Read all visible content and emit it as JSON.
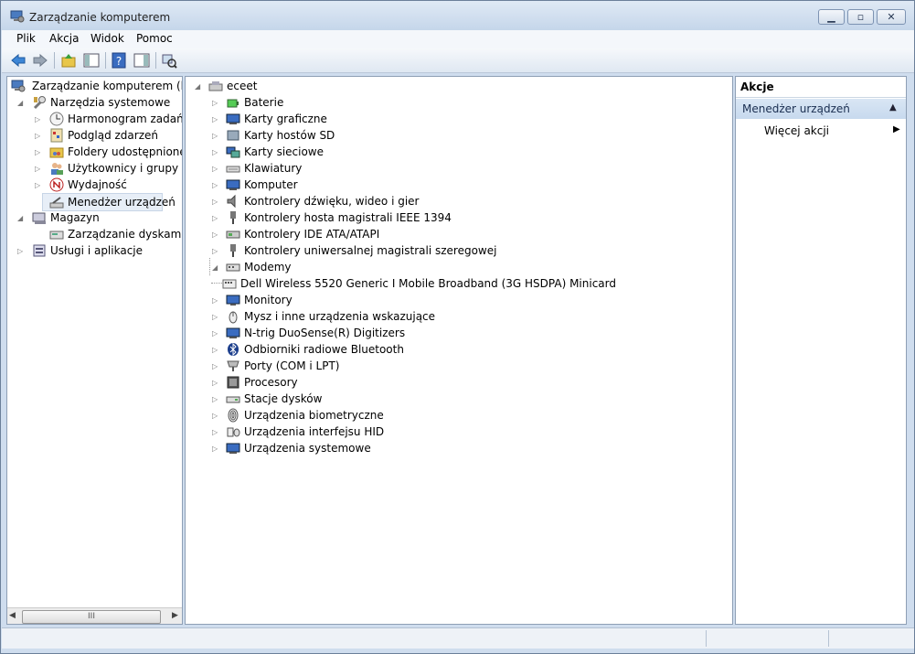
{
  "window": {
    "title": "Zarządzanie komputerem"
  },
  "menu": [
    "Plik",
    "Akcja",
    "Widok",
    "Pomoc"
  ],
  "left_tree": {
    "root": "Zarządzanie komputerem (loka",
    "system_tools": "Narzędzia systemowe",
    "items": [
      "Harmonogram zadań",
      "Podgląd zdarzeń",
      "Foldery udostępnione",
      "Użytkownicy i grupy lok",
      "Wydajność",
      "Menedżer urządzeń"
    ],
    "storage": "Magazyn",
    "disk_mgmt": "Zarządzanie dyskami",
    "services": "Usługi i aplikacje",
    "scroll_thumb": "III"
  },
  "device_tree": {
    "computer": "eceet",
    "categories": [
      {
        "label": "Baterie",
        "icon": "battery-icon"
      },
      {
        "label": "Karty graficzne",
        "icon": "display-adapter-icon"
      },
      {
        "label": "Karty hostów SD",
        "icon": "sd-host-icon"
      },
      {
        "label": "Karty sieciowe",
        "icon": "network-adapter-icon"
      },
      {
        "label": "Klawiatury",
        "icon": "keyboard-icon"
      },
      {
        "label": "Komputer",
        "icon": "computer-icon"
      },
      {
        "label": "Kontrolery dźwięku, wideo i gier",
        "icon": "speaker-icon"
      },
      {
        "label": "Kontrolery hosta magistrali IEEE 1394",
        "icon": "ieee1394-icon"
      },
      {
        "label": "Kontrolery IDE ATA/ATAPI",
        "icon": "ide-controller-icon"
      },
      {
        "label": "Kontrolery uniwersalnej magistrali szeregowej",
        "icon": "usb-icon"
      },
      {
        "label": "Modemy",
        "icon": "modem-icon",
        "expanded": true
      },
      {
        "label": "Monitory",
        "icon": "monitor-icon"
      },
      {
        "label": "Mysz i inne urządzenia wskazujące",
        "icon": "mouse-icon"
      },
      {
        "label": "N-trig DuoSense(R) Digitizers",
        "icon": "digitizer-icon"
      },
      {
        "label": "Odbiorniki radiowe Bluetooth",
        "icon": "bluetooth-icon"
      },
      {
        "label": "Porty (COM i LPT)",
        "icon": "port-icon"
      },
      {
        "label": "Procesory",
        "icon": "processor-icon"
      },
      {
        "label": "Stacje dysków",
        "icon": "disk-drive-icon"
      },
      {
        "label": "Urządzenia biometryczne",
        "icon": "fingerprint-icon"
      },
      {
        "label": "Urządzenia interfejsu HID",
        "icon": "hid-icon"
      },
      {
        "label": "Urządzenia systemowe",
        "icon": "system-device-icon"
      }
    ],
    "modem_child": "Dell Wireless 5520 Generic I Mobile Broadband (3G HSDPA) Minicard"
  },
  "actions": {
    "header": "Akcje",
    "section": "Menedżer urządzeń",
    "more": "Więcej akcji"
  }
}
